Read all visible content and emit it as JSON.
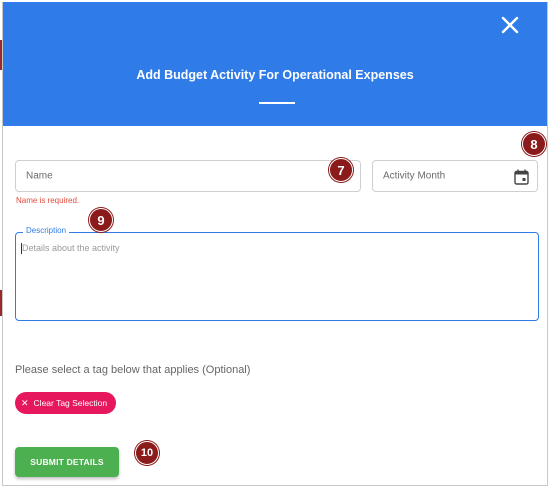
{
  "dialog": {
    "title": "Add Budget Activity For Operational Expenses",
    "header_color": "#2f7be8"
  },
  "form": {
    "name_placeholder": "Name",
    "name_error": "Name is required.",
    "month_placeholder": "Activity Month",
    "description_label": "Description",
    "description_placeholder": "Details about the activity",
    "tag_prompt": "Please select a tag below that applies (Optional)",
    "clear_tag_label": "Clear Tag Selection",
    "submit_label": "SUBMIT DETAILS"
  },
  "annotations": {
    "badge_7": "7",
    "badge_8": "8",
    "badge_9": "9",
    "badge_10": "10"
  },
  "colors": {
    "accent": "#2f7be8",
    "error": "#e04a3a",
    "chip": "#e6175c",
    "submit": "#4caf50",
    "annotation_badge": "#8b1a1a"
  },
  "icons": [
    "close-icon",
    "calendar-icon",
    "clear-chip-x-icon"
  ]
}
